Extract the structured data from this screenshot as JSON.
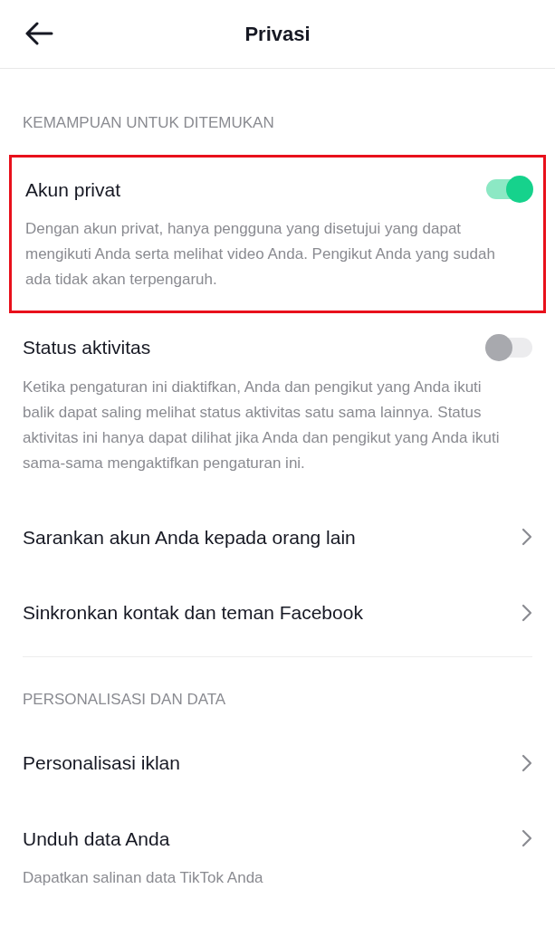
{
  "header": {
    "title": "Privasi"
  },
  "sections": [
    {
      "heading": "KEMAMPUAN UNTUK DITEMUKAN",
      "items": [
        {
          "kind": "toggle",
          "label": "Akun privat",
          "on": true,
          "highlighted": true,
          "description": "Dengan akun privat, hanya pengguna yang disetujui yang dapat mengikuti Anda serta melihat video Anda. Pengikut Anda yang sudah ada tidak akan terpengaruh."
        },
        {
          "kind": "toggle",
          "label": "Status aktivitas",
          "on": false,
          "highlighted": false,
          "description": "Ketika pengaturan ini diaktifkan, Anda dan pengikut yang Anda ikuti balik dapat saling melihat status aktivitas satu sama lainnya. Status aktivitas ini hanya dapat dilihat jika Anda dan pengikut yang Anda ikuti sama-sama mengaktifkan pengaturan ini."
        },
        {
          "kind": "link",
          "label": "Sarankan akun Anda kepada orang lain"
        },
        {
          "kind": "link",
          "label": "Sinkronkan kontak dan teman Facebook"
        }
      ]
    },
    {
      "heading": "PERSONALISASI DAN DATA",
      "items": [
        {
          "kind": "link",
          "label": "Personalisasi iklan"
        },
        {
          "kind": "link",
          "label": "Unduh data Anda",
          "description": "Dapatkan salinan data TikTok Anda"
        }
      ]
    }
  ]
}
